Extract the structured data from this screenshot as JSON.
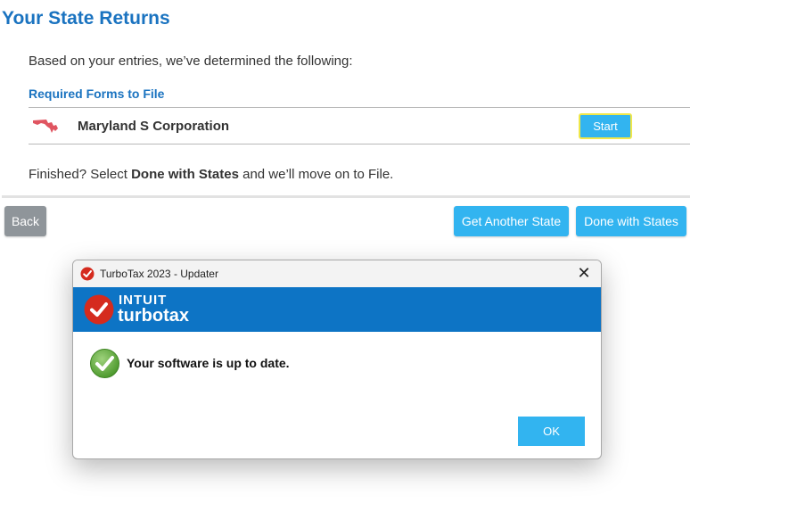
{
  "page": {
    "title": "Your State Returns",
    "intro": "Based on your entries, we’ve determined the following:",
    "required_heading": "Required Forms to File",
    "states": [
      {
        "name": "Maryland S Corporation",
        "flag_icon": "maryland-state-icon",
        "action_label": "Start"
      }
    ],
    "finished": {
      "prefix": "Finished? Select ",
      "bold": "Done with States",
      "suffix": " and we’ll move on to File."
    },
    "buttons": {
      "back": "Back",
      "get_another": "Get Another State",
      "done": "Done with States"
    }
  },
  "dialog": {
    "title": "TurboTax 2023 - Updater",
    "close_icon": "close-icon",
    "banner": {
      "brand_top": "INTUIT",
      "brand_bottom": "turbotax"
    },
    "message": "Your software is up to date.",
    "ok_label": "OK"
  },
  "colors": {
    "accent_blue": "#1a73c0",
    "button_blue": "#32b4f0",
    "button_gray": "#8f959a",
    "banner_blue": "#0d74c5",
    "turbotax_red": "#d52b1e",
    "check_green": "#5cab3a"
  }
}
